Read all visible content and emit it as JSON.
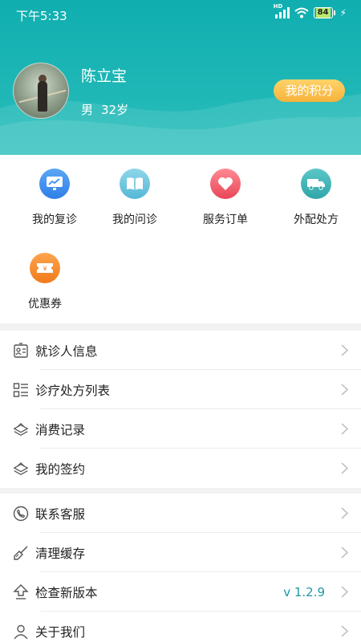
{
  "status_bar": {
    "time": "下午5:33",
    "network": "HD",
    "battery": "84"
  },
  "profile": {
    "name": "陈立宝",
    "gender": "男",
    "age": "32岁",
    "points_button": "我的积分"
  },
  "quick_actions": [
    {
      "label": "我的复诊",
      "icon": "monitor-chart-icon",
      "color": "#3d8ff0"
    },
    {
      "label": "我的问诊",
      "icon": "open-book-icon",
      "color": "#67c3df"
    },
    {
      "label": "服务订单",
      "icon": "heart-icon",
      "color": "#ef5b6a"
    },
    {
      "label": "外配处方",
      "icon": "delivery-truck-icon",
      "color": "#3fb3b6"
    },
    {
      "label": "优惠券",
      "icon": "coupon-ticket-icon",
      "color": "#f58a2a"
    }
  ],
  "menu_section_1": [
    {
      "label": "就诊人信息",
      "icon": "id-card-icon"
    },
    {
      "label": "诊疗处方列表",
      "icon": "list-icon"
    },
    {
      "label": "消费记录",
      "icon": "stack-icon"
    },
    {
      "label": "我的签约",
      "icon": "stack-icon"
    }
  ],
  "menu_section_2": [
    {
      "label": "联系客服",
      "icon": "phone-icon"
    },
    {
      "label": "清理缓存",
      "icon": "broom-icon"
    },
    {
      "label": "检查新版本",
      "icon": "upload-arrow-icon",
      "value": "v 1.2.9"
    },
    {
      "label": "关于我们",
      "icon": "user-icon"
    }
  ]
}
